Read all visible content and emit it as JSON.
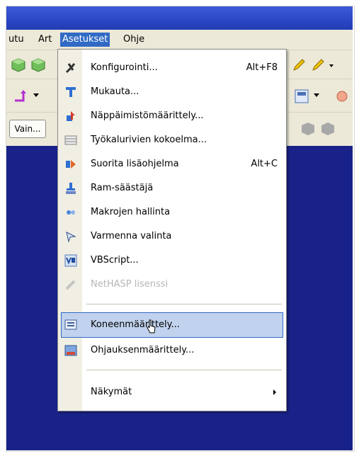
{
  "menubar": {
    "items": [
      "utu",
      "Art",
      "Asetukset",
      "Ohje"
    ]
  },
  "toolbar": {
    "vain_label": "Vain..."
  },
  "dropdown": {
    "items": [
      {
        "label": "Konfigurointi...",
        "shortcut": "Alt+F8",
        "icon": "wrench-config-icon"
      },
      {
        "label": "Mukauta...",
        "shortcut": "",
        "icon": "customize-icon"
      },
      {
        "label": "Näppäimistömäärittely...",
        "shortcut": "",
        "icon": "keyboard-setup-icon"
      },
      {
        "label": "Työkalurivien kokoelma...",
        "shortcut": "",
        "icon": "toolbar-collection-icon"
      },
      {
        "label": "Suorita lisäohjelma",
        "shortcut": "Alt+C",
        "icon": "run-addin-icon"
      },
      {
        "label": "Ram-säästäjä",
        "shortcut": "",
        "icon": "ram-saver-icon"
      },
      {
        "label": "Makrojen hallinta",
        "shortcut": "",
        "icon": "macro-manager-icon"
      },
      {
        "label": "Varmenna valinta",
        "shortcut": "",
        "icon": "verify-selection-icon"
      },
      {
        "label": "VBScript...",
        "shortcut": "",
        "icon": "vbscript-icon"
      },
      {
        "label": "NetHASP lisenssi",
        "shortcut": "",
        "icon": "nethasp-license-icon"
      },
      {
        "label": "Koneenmäärittely...",
        "shortcut": "",
        "icon": "machine-definition-icon"
      },
      {
        "label": "Ohjauksenmäärittely...",
        "shortcut": "",
        "icon": "control-definition-icon"
      },
      {
        "label": "Näkymät",
        "shortcut": "",
        "icon": "views-icon"
      }
    ]
  },
  "colors": {
    "titlebar": "#2b46c4",
    "workspace": "#192288",
    "menu_highlight": "#316ac5",
    "item_highlight": "#c1d2ee"
  }
}
